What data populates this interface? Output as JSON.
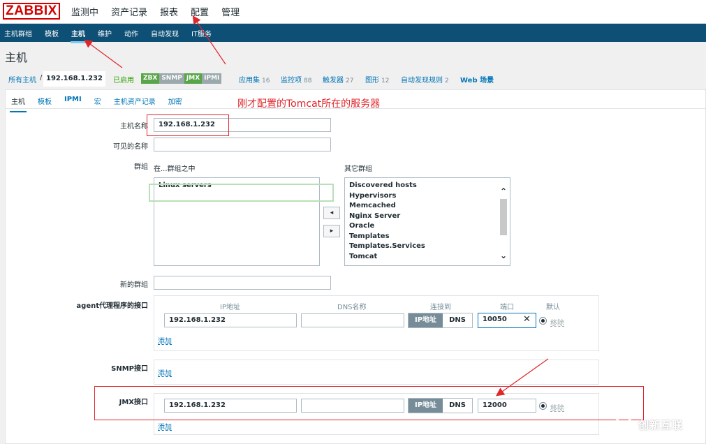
{
  "header": {
    "logo": "ZABBIX",
    "menu": [
      "监测中",
      "资产记录",
      "报表",
      "配置",
      "管理"
    ]
  },
  "submenu": [
    "主机群组",
    "模板",
    "主机",
    "维护",
    "动作",
    "自动发现",
    "IT服务"
  ],
  "page_title": "主机",
  "breadcrumbs": {
    "all_hosts": "所有主机",
    "separator": "/",
    "current": "192.168.1.232",
    "enabled": "已启用",
    "availability": [
      "ZBX",
      "SNMP",
      "JMX",
      "IPMI"
    ],
    "counters": [
      {
        "label": "应用集",
        "count": "16"
      },
      {
        "label": "监控项",
        "count": "88"
      },
      {
        "label": "触发器",
        "count": "27"
      },
      {
        "label": "图形",
        "count": "12"
      },
      {
        "label": "自动发现规则",
        "count": "2"
      },
      {
        "label": "Web 场景",
        "count": ""
      }
    ]
  },
  "tabs": [
    "主机",
    "模板",
    "IPMI",
    "宏",
    "主机资产记录",
    "加密"
  ],
  "form": {
    "host_name_label": "主机名称",
    "host_name_value": "192.168.1.232",
    "visible_name_label": "可见的名称",
    "visible_name_value": "",
    "groups_label": "群组",
    "in_groups_label": "在...群组之中",
    "other_groups_label": "其它群组",
    "in_groups": [
      "Linux servers"
    ],
    "other_groups": [
      "Discovered hosts",
      "Hypervisors",
      "Memcached",
      "Nginx Server",
      "Oracle",
      "Templates",
      "Templates.Services",
      "Tomcat"
    ],
    "move_left": "◂",
    "move_right": "▸",
    "new_group_label": "新的群组",
    "new_group_value": ""
  },
  "interfaces": {
    "agent_label": "agent代理程序的接口",
    "snmp_label": "SNMP接口",
    "jmx_label": "JMX接口",
    "col_ip": "IP地址",
    "col_dns": "DNS名称",
    "col_connect": "连接到",
    "col_port": "端口",
    "col_default": "默认",
    "btn_ip": "IP地址",
    "btn_dns": "DNS",
    "remove": "移除",
    "add": "添加",
    "agent": {
      "ip": "192.168.1.232",
      "dns": "",
      "port": "10050"
    },
    "jmx": {
      "ip": "192.168.1.232",
      "dns": "",
      "port": "12000"
    }
  },
  "annotation": "刚才配置的Tomcat所在的服务器",
  "watermark": "创新互联",
  "colors": {
    "brand": "#d40000",
    "nav": "#0e4f75",
    "link": "#0275b8",
    "annotation": "#e0252b"
  }
}
